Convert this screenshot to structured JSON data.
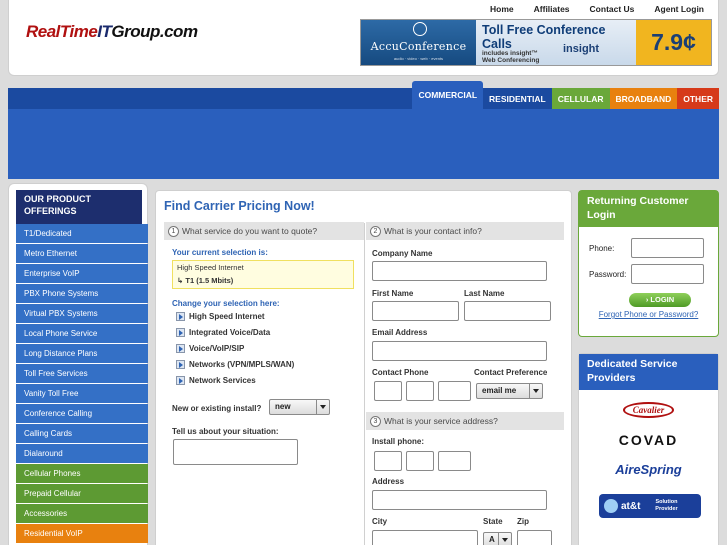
{
  "header": {
    "logo": {
      "part1": "RealTime",
      "part2": "IT",
      "part3": "Group.com"
    },
    "links": [
      "Home",
      "Affiliates",
      "Contact Us",
      "Agent Login"
    ]
  },
  "ad": {
    "brand": "AccuConference",
    "tagline": "audio · video · web · events",
    "headline": "Toll Free Conference Calls",
    "sub1": "includes insight™",
    "sub2": "Web Conferencing",
    "insight": "insight",
    "price": "7.9¢"
  },
  "nav": {
    "tabs": [
      "COMMERCIAL",
      "RESIDENTIAL",
      "CELLULAR",
      "BROADBAND",
      "OTHER"
    ]
  },
  "sidebar": {
    "title": "OUR PRODUCT OFFERINGS",
    "items": [
      {
        "label": "T1/Dedicated",
        "color": "blue"
      },
      {
        "label": "Metro Ethernet",
        "color": "blue"
      },
      {
        "label": "Enterprise VoIP",
        "color": "blue"
      },
      {
        "label": "PBX Phone Systems",
        "color": "blue"
      },
      {
        "label": "Virtual PBX Systems",
        "color": "blue"
      },
      {
        "label": "Local Phone Service",
        "color": "blue"
      },
      {
        "label": "Long Distance Plans",
        "color": "blue"
      },
      {
        "label": "Toll Free Services",
        "color": "blue"
      },
      {
        "label": "Vanity Toll Free",
        "color": "blue"
      },
      {
        "label": "Conference Calling",
        "color": "blue"
      },
      {
        "label": "Calling Cards",
        "color": "blue"
      },
      {
        "label": "Dialaround",
        "color": "blue"
      },
      {
        "label": "Cellular Phones",
        "color": "green"
      },
      {
        "label": "Prepaid Cellular",
        "color": "green"
      },
      {
        "label": "Accessories",
        "color": "green"
      },
      {
        "label": "Residential VoIP",
        "color": "orange"
      }
    ]
  },
  "form": {
    "title": "Find Carrier Pricing Now!",
    "section1": {
      "num": "1",
      "title": "What service do you want to quote?"
    },
    "section2": {
      "num": "2",
      "title": "What is your contact info?"
    },
    "section3": {
      "num": "3",
      "title": "What is your service address?"
    },
    "current_label": "Your current selection is:",
    "current_service": "High Speed Internet",
    "current_detail": "T1 (1.5 Mbits)",
    "change_label": "Change your selection here:",
    "services": [
      "High Speed Internet",
      "Integrated Voice/Data",
      "Voice/VoIP/SIP",
      "Networks (VPN/MPLS/WAN)",
      "Network Services"
    ],
    "install_label": "New or existing install?",
    "install_value": "new",
    "situation_label": "Tell us about your situation:",
    "company_label": "Company Name",
    "first_label": "First Name",
    "last_label": "Last Name",
    "email_label": "Email Address",
    "phone_label": "Contact Phone",
    "pref_label": "Contact Preference",
    "pref_value": "email me",
    "install_phone_label": "Install phone:",
    "address_label": "Address",
    "city_label": "City",
    "state_label": "State",
    "zip_label": "Zip",
    "state_value": "A"
  },
  "login": {
    "title": "Returning Customer Login",
    "phone_label": "Phone:",
    "password_label": "Password:",
    "button": "› LOGIN",
    "forgot": "Forgot Phone or Password?"
  },
  "providers": {
    "title": "Dedicated Service Providers",
    "items": [
      "Cavalier",
      "COVAD",
      "AireSpring",
      "at&t",
      "Solution Provider"
    ]
  }
}
